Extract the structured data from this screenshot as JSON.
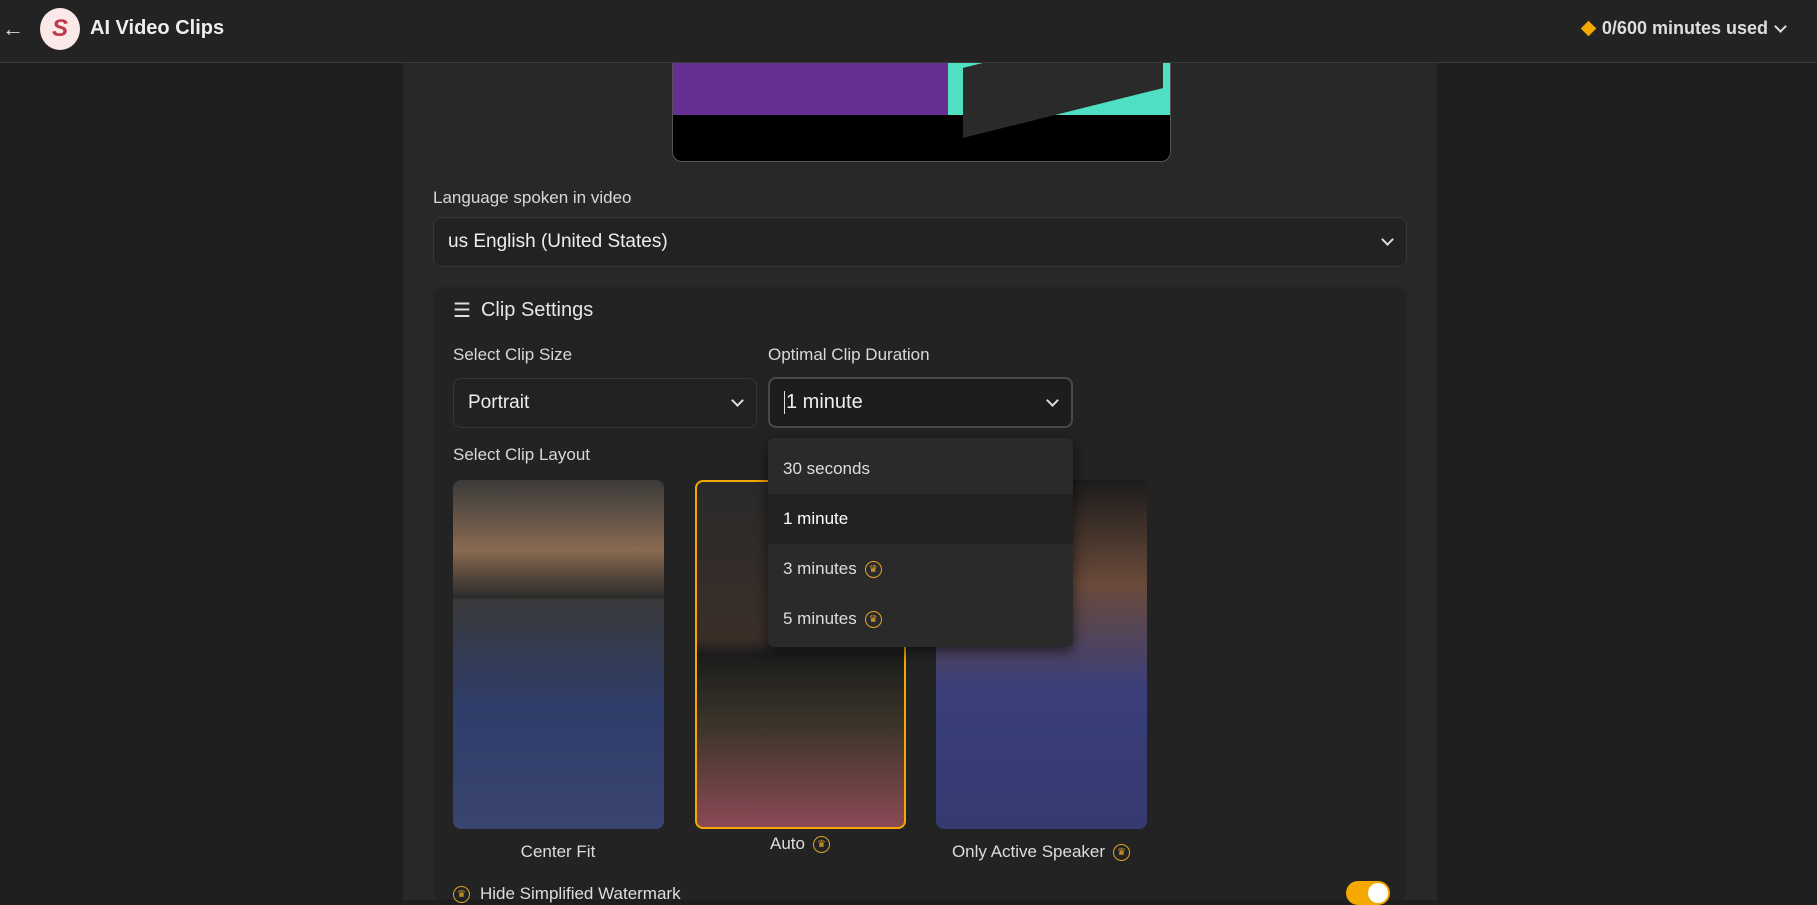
{
  "header": {
    "title": "AI Video Clips",
    "usage": "0/600 minutes used",
    "accent": "#f5a800"
  },
  "language": {
    "label": "Language spoken in video",
    "value": "us English (United States)"
  },
  "clip_settings": {
    "title": "Clip Settings",
    "size_label": "Select Clip Size",
    "size_value": "Portrait",
    "duration_label": "Optimal Clip Duration",
    "duration_value": "1 minute",
    "duration_options": [
      {
        "label": "30 seconds",
        "premium": false
      },
      {
        "label": "1 minute",
        "premium": false,
        "selected": true
      },
      {
        "label": "3 minutes",
        "premium": true
      },
      {
        "label": "5 minutes",
        "premium": true
      }
    ],
    "layout_label": "Select Clip Layout",
    "layouts": [
      {
        "label": "Center Fit",
        "premium": false
      },
      {
        "label": "Auto",
        "premium": true,
        "selected": true
      },
      {
        "label": "Only Active Speaker",
        "premium": true
      }
    ],
    "watermark_label": "Hide Simplified Watermark",
    "watermark_on": true
  }
}
